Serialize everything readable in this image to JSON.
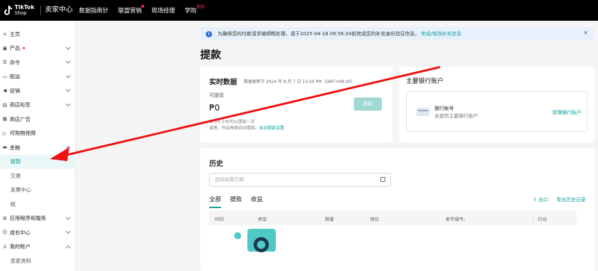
{
  "topbar": {
    "logo_line1": "TikTok",
    "logo_line2": "Shop",
    "seller_center": "卖家中心",
    "nav": [
      {
        "label": "数据指南针"
      },
      {
        "label": "联盟营销"
      },
      {
        "label": "现场经理"
      },
      {
        "label": "学院",
        "badge": "新的"
      }
    ]
  },
  "sidebar": {
    "items": [
      {
        "label": "主页",
        "icon": "home-icon"
      },
      {
        "label": "产品",
        "icon": "product-icon"
      },
      {
        "label": "命令",
        "icon": "order-icon"
      },
      {
        "label": "船运",
        "icon": "shipping-icon"
      },
      {
        "label": "促销",
        "icon": "promotion-icon"
      },
      {
        "label": "商店标签",
        "icon": "store-tag-icon"
      },
      {
        "label": "商店广告",
        "icon": "store-ads-icon"
      },
      {
        "label": "可购物视频",
        "icon": "video-icon"
      },
      {
        "label": "金融",
        "icon": "finance-icon"
      }
    ],
    "finance_sub": [
      "提款",
      "交易",
      "发票中心",
      "税"
    ],
    "items2": [
      {
        "label": "应用程序和服务",
        "icon": "apps-icon"
      },
      {
        "label": "成长中心",
        "icon": "growth-icon"
      },
      {
        "label": "我的账户",
        "icon": "account-icon"
      }
    ],
    "account_sub": [
      "卖家资料"
    ]
  },
  "banner": {
    "text": "为确保您的付款请求被顺畅处理，请于2025-04-18 09:56:34前完成您的补充身份验证信息。",
    "link": "完成/修改补充信息"
  },
  "page_title": "提款",
  "realtime": {
    "title": "实时数据",
    "updated": "数据更新于 2024 年 8 月 7 日 13:59 PM（GMT+08:00）",
    "label": "可提现",
    "amount": "₱0",
    "note1": "每 24 小时可以提款一次",
    "note2_prefix": "或者，开启每周自动提款。",
    "note2_link": "自动提款设置",
    "withdraw_button": "提取"
  },
  "bank": {
    "title": "主要银行账户",
    "name": "银行帐号",
    "sub": "未提供主要银行账户",
    "manage": "管理银行账户"
  },
  "history": {
    "title": "历史",
    "date_placeholder": "选择结算日期",
    "tabs": [
      "全部",
      "提款",
      "收益"
    ],
    "export": "出口",
    "export_history": "导出历史记录",
    "columns": [
      "时间",
      "类型",
      "数量",
      "地位",
      "参考编号。",
      "行动"
    ]
  },
  "colors": {
    "accent": "#0a9b9b",
    "arrow": "#ee1111",
    "topbar": "#000000"
  }
}
